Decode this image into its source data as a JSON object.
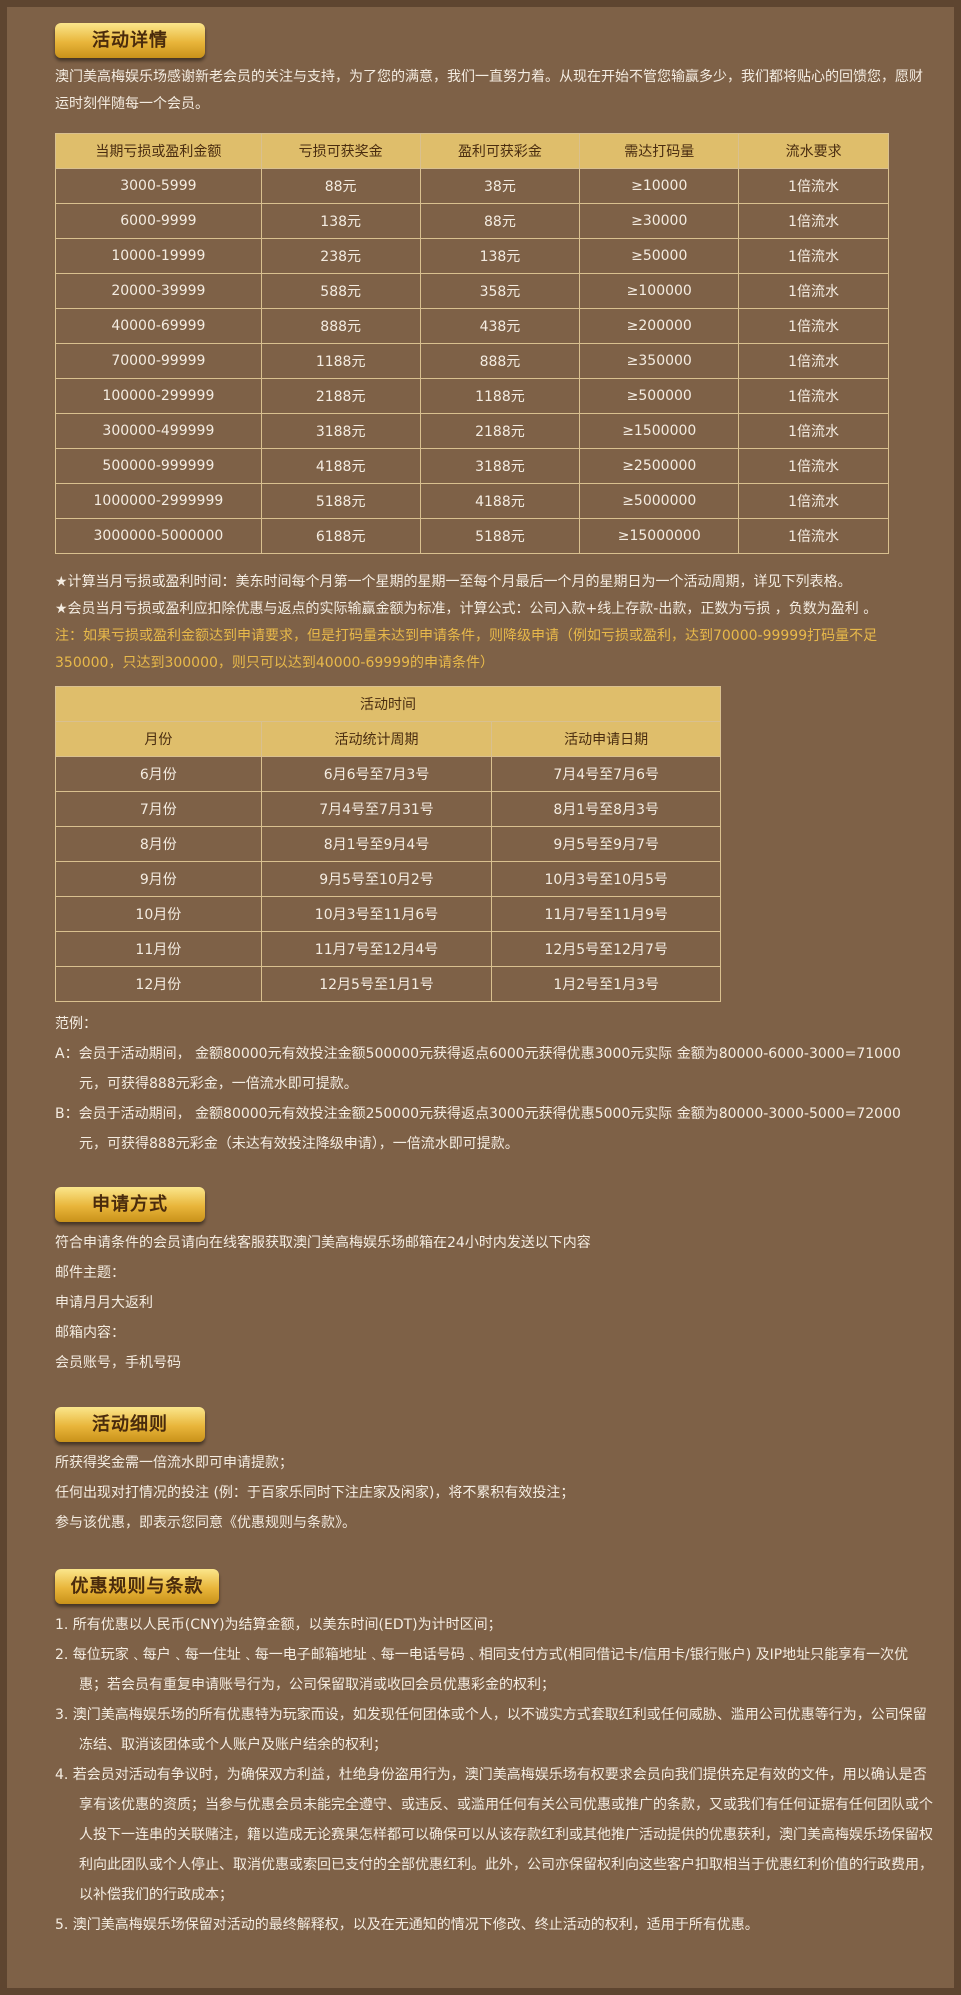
{
  "section1": {
    "title": "活动详情",
    "intro": "澳门美高梅娱乐场感谢新老会员的关注与支持，为了您的满意，我们一直努力着。从现在开始不管您输赢多少，我们都将贴心的回馈您，愿财运时刻伴随每一个会员。",
    "table1": {
      "headers": [
        "当期亏损或盈利金额",
        "亏损可获奖金",
        "盈利可获彩金",
        "需达打码量",
        "流水要求"
      ],
      "rows": [
        [
          "3000-5999",
          "88元",
          "38元",
          "≥10000",
          "1倍流水"
        ],
        [
          "6000-9999",
          "138元",
          "88元",
          "≥30000",
          "1倍流水"
        ],
        [
          "10000-19999",
          "238元",
          "138元",
          "≥50000",
          "1倍流水"
        ],
        [
          "20000-39999",
          "588元",
          "358元",
          "≥100000",
          "1倍流水"
        ],
        [
          "40000-69999",
          "888元",
          "438元",
          "≥200000",
          "1倍流水"
        ],
        [
          "70000-99999",
          "1188元",
          "888元",
          "≥350000",
          "1倍流水"
        ],
        [
          "100000-299999",
          "2188元",
          "1188元",
          "≥500000",
          "1倍流水"
        ],
        [
          "300000-499999",
          "3188元",
          "2188元",
          "≥1500000",
          "1倍流水"
        ],
        [
          "500000-999999",
          "4188元",
          "3188元",
          "≥2500000",
          "1倍流水"
        ],
        [
          "1000000-2999999",
          "5188元",
          "4188元",
          "≥5000000",
          "1倍流水"
        ],
        [
          "3000000-5000000",
          "6188元",
          "5188元",
          "≥15000000",
          "1倍流水"
        ]
      ]
    },
    "note1": "★计算当月亏损或盈利时间：美东时间每个月第一个星期的星期一至每个月最后一个月的星期日为一个活动周期，详见下列表格。",
    "note2": "★会员当月亏损或盈利应扣除优惠与返点的实际输赢金额为标准，计算公式：公司入款+线上存款-出款，正数为亏损 ，负数为盈利 。",
    "note3": "注：如果亏损或盈利金额达到申请要求，但是打码量未达到申请条件，则降级申请（例如亏损或盈利，达到70000-99999打码量不足350000，只达到300000，则只可以达到40000-69999的申请条件）",
    "table2": {
      "caption": "活动时间",
      "headers": [
        "月份",
        "活动统计周期",
        "活动申请日期"
      ],
      "rows": [
        [
          "6月份",
          "6月6号至7月3号",
          "7月4号至7月6号"
        ],
        [
          "7月份",
          "7月4号至7月31号",
          "8月1号至8月3号"
        ],
        [
          "8月份",
          "8月1号至9月4号",
          "9月5号至9月7号"
        ],
        [
          "9月份",
          "9月5号至10月2号",
          "10月3号至10月5号"
        ],
        [
          "10月份",
          "10月3号至11月6号",
          "11月7号至11月9号"
        ],
        [
          "11月份",
          "11月7号至12月4号",
          "12月5号至12月7号"
        ],
        [
          "12月份",
          "12月5号至1月1号",
          "1月2号至1月3号"
        ]
      ]
    },
    "example_label": "范例：",
    "example_a": "A：会员于活动期间， 金额80000元有效投注金额500000元获得返点6000元获得优惠3000元实际 金额为80000-6000-3000=71000元，可获得888元彩金，一倍流水即可提款。",
    "example_b": "B：会员于活动期间， 金额80000元有效投注金额250000元获得返点3000元获得优惠5000元实际 金额为80000-3000-5000=72000元，可获得888元彩金（未达有效投注降级申请），一倍流水即可提款。"
  },
  "section2": {
    "title": "申请方式",
    "lines": [
      "符合申请条件的会员请向在线客服获取澳门美高梅娱乐场邮箱在24小时内发送以下内容",
      "邮件主题：",
      "申请月月大返利",
      "邮箱内容：",
      "会员账号，手机号码"
    ]
  },
  "section3": {
    "title": "活动细则",
    "lines": [
      "所获得奖金需一倍流水即可申请提款；",
      "任何出现对打情况的投注 (例：于百家乐同时下注庄家及闲家)，将不累积有效投注；",
      "参与该优惠，即表示您同意《优惠规则与条款》。"
    ]
  },
  "section4": {
    "title": "优惠规则与条款",
    "items": [
      "1. 所有优惠以人民币(CNY)为结算金额，以美东时间(EDT)为计时区间；",
      "2. 每位玩家﹑每户﹑每一住址﹑每一电子邮箱地址﹑每一电话号码﹑相同支付方式(相同借记卡/信用卡/银行账户) 及IP地址只能享有一次优惠；若会员有重复申请账号行为，公司保留取消或收回会员优惠彩金的权利；",
      "3. 澳门美高梅娱乐场的所有优惠特为玩家而设，如发现任何团体或个人，以不诚实方式套取红利或任何威胁、滥用公司优惠等行为，公司保留冻结、取消该团体或个人账户及账户结余的权利；",
      "4. 若会员对活动有争议时，为确保双方利益，杜绝身份盗用行为，澳门美高梅娱乐场有权要求会员向我们提供充足有效的文件，用以确认是否享有该优惠的资质；当参与优惠会员未能完全遵守、或违反、或滥用任何有关公司优惠或推广的条款，又或我们有任何证据有任何团队或个人投下一连串的关联赌注，籍以造成无论赛果怎样都可以确保可以从该存款红利或其他推广活动提供的优惠获利，澳门美高梅娱乐场保留权利向此团队或个人停止、取消优惠或索回已支付的全部优惠红利。此外，公司亦保留权利向这些客户扣取相当于优惠红利价值的行政费用，以补偿我们的行政成本；",
      "5. 澳门美高梅娱乐场保留对活动的最终解释权，以及在无通知的情况下修改、终止活动的权利，适用于所有优惠。"
    ]
  }
}
